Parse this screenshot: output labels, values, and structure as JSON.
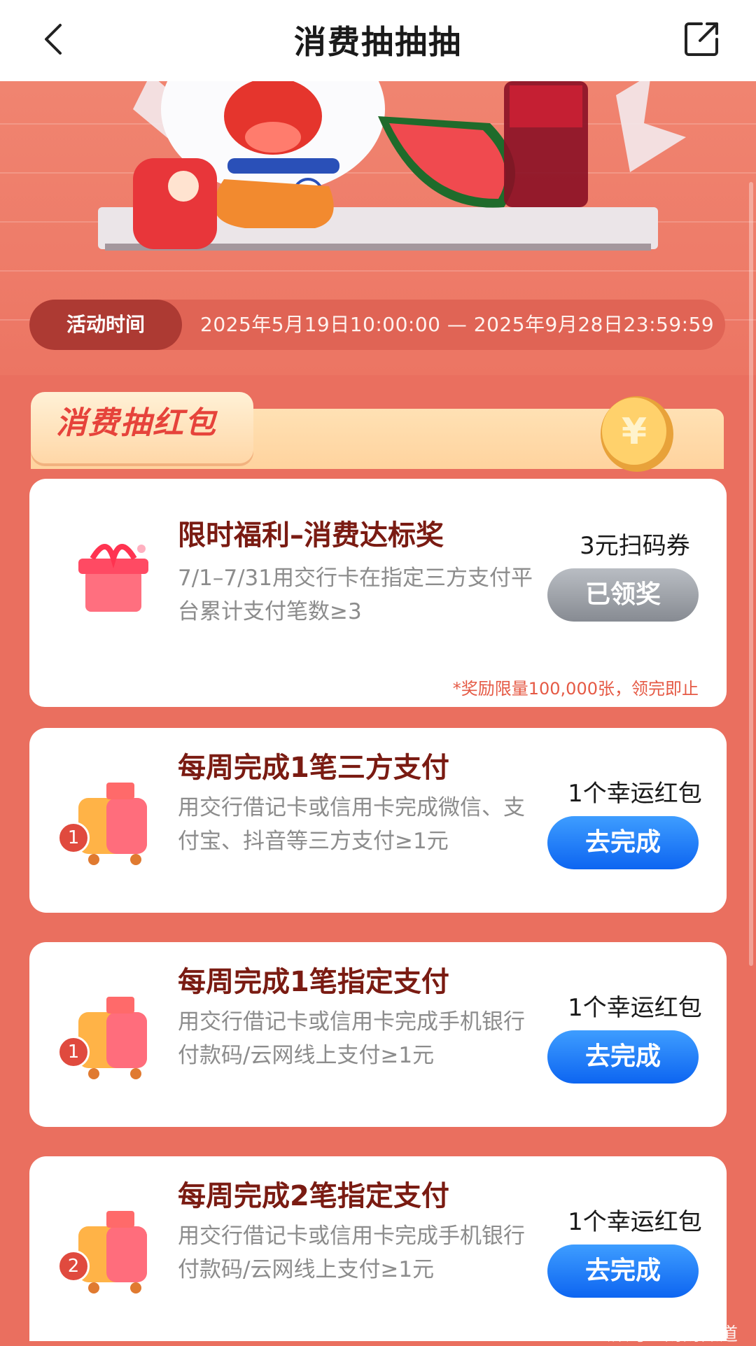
{
  "header": {
    "title": "消费抽抽抽",
    "back_icon": "back-arrow-icon",
    "share_icon": "share-icon"
  },
  "activity": {
    "time_label": "活动时间",
    "time_range": "2025年5月19日10:00:00 — 2025年9月28日23:59:59"
  },
  "section": {
    "title": "消费抽红包"
  },
  "tasks": [
    {
      "title": "限时福利–消费达标奖",
      "desc": "7/1–7/31用交行卡在指定三方支付平台累计支付笔数≥3",
      "reward": "3元扫码券",
      "button": "已领奖",
      "button_state": "done",
      "note": "*奖励限量100,000张，领完即止"
    },
    {
      "title": "每周完成1笔三方支付",
      "desc": "用交行借记卡或信用卡完成微信、支付宝、抖音等三方支付≥1元",
      "reward": "1个幸运红包",
      "button": "去完成",
      "badge": "1"
    },
    {
      "title": "每周完成1笔指定支付",
      "desc": "用交行借记卡或信用卡完成手机银行付款码/云网线上支付≥1元",
      "reward": "1个幸运红包",
      "button": "去完成",
      "badge": "1"
    },
    {
      "title": "每周完成2笔指定支付",
      "desc": "用交行借记卡或信用卡完成手机银行付款码/云网线上支付≥1元",
      "reward": "1个幸运红包",
      "button": "去完成",
      "badge": "2"
    }
  ],
  "watermark": "公众号 · 财财知道",
  "colors": {
    "page_bg": "#ea6f5f",
    "title_red": "#7a1b12",
    "primary_blue": "#0d65f1",
    "disabled_gray": "#878b92"
  }
}
